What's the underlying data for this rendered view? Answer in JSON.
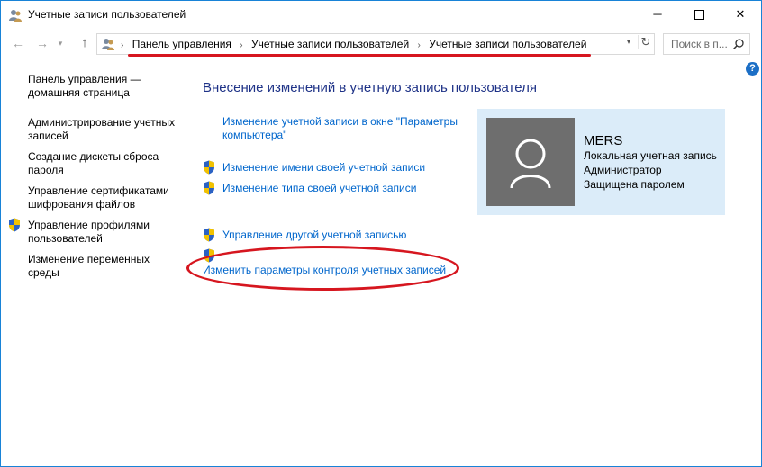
{
  "window": {
    "title": "Учетные записи пользователей",
    "controls": {
      "minimize": "─",
      "close": "✕"
    }
  },
  "addressbar": {
    "back": "←",
    "forward": "→",
    "dropdown": "▾",
    "up": "↑",
    "crumbs": [
      "Панель управления",
      "Учетные записи пользователей",
      "Учетные записи пользователей"
    ],
    "crumb_separator": "›",
    "refresh": "↻",
    "search_placeholder": "Поиск в п...",
    "help": "?"
  },
  "sidebar": {
    "items": [
      {
        "label_lines": [
          "Панель управления —",
          "домашняя страница"
        ],
        "shield": false
      },
      {
        "label_lines": [
          "Администрирование учетных",
          "записей"
        ],
        "shield": false
      },
      {
        "label_lines": [
          "Создание дискеты сброса",
          "пароля"
        ],
        "shield": false
      },
      {
        "label_lines": [
          "Управление сертификатами",
          "шифрования файлов"
        ],
        "shield": false
      },
      {
        "label_lines": [
          "Управление профилями",
          "пользователей"
        ],
        "shield": true
      },
      {
        "label_lines": [
          "Изменение переменных",
          "среды"
        ],
        "shield": false
      }
    ]
  },
  "main": {
    "title": "Внесение изменений в учетную запись пользователя",
    "tasks": [
      {
        "label_lines": [
          "Изменение учетной записи в окне \"Параметры",
          "компьютера\""
        ],
        "shield": false
      },
      {
        "label_lines": [
          "Изменение имени своей учетной записи"
        ],
        "shield": true
      },
      {
        "label_lines": [
          "Изменение типа своей учетной записи"
        ],
        "shield": true
      },
      {
        "label_lines": [
          "Управление другой учетной записью"
        ],
        "shield": true
      },
      {
        "label_lines": [
          "Изменить параметры контроля учетных записей"
        ],
        "shield": true
      }
    ]
  },
  "user": {
    "name": "MERS",
    "account_type": "Локальная учетная запись",
    "role": "Администратор",
    "password_status": "Защищена паролем"
  },
  "colors": {
    "link": "#0066cc",
    "heading": "#1e3287",
    "panel_bg": "#dbecf9",
    "avatar_bg": "#6e6e6e",
    "highlight_red": "#d6161f"
  },
  "icons": {
    "title": "users-icon",
    "address": "control-panel-users-icon",
    "search": "search-icon",
    "shield": "uac-shield-icon",
    "avatar": "user-silhouette-icon"
  }
}
